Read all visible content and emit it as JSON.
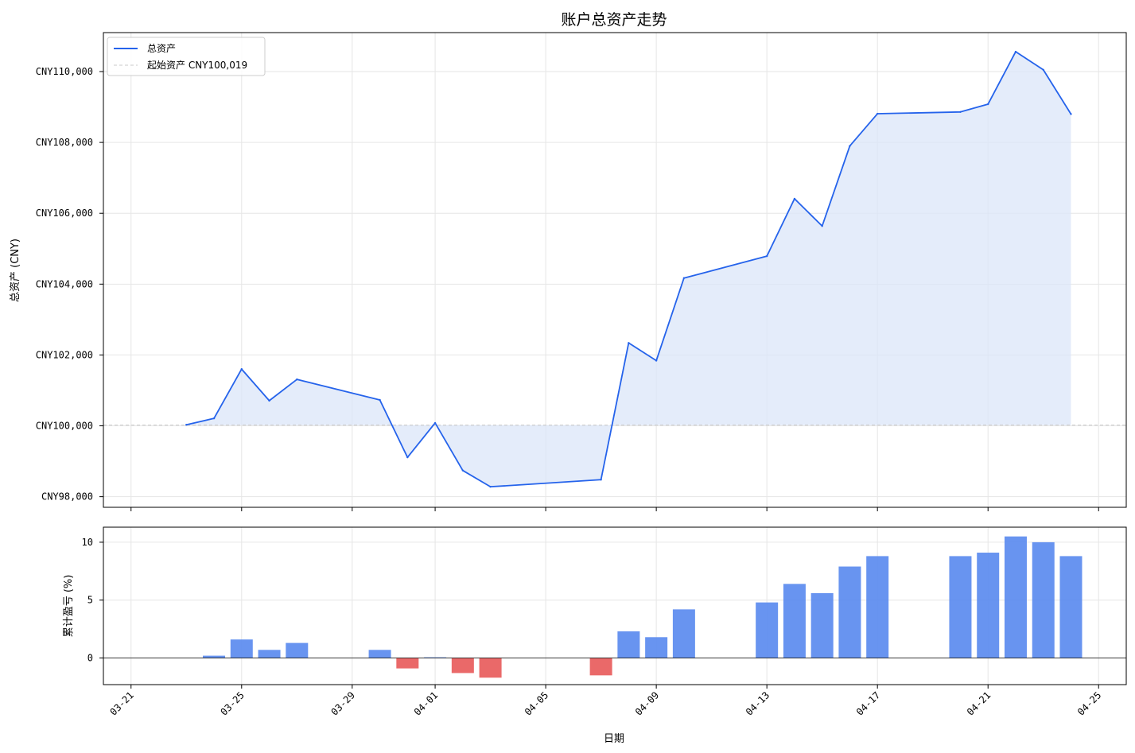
{
  "chart_data": [
    {
      "type": "area",
      "title": "账户总资产走势",
      "xlabel": "",
      "ylabel": "总资产 (CNY)",
      "ylim": [
        97700,
        111100
      ],
      "xlim": [
        "2024-03-20",
        "2024-04-26"
      ],
      "y_ticks": [
        98000,
        100000,
        102000,
        104000,
        106000,
        108000,
        110000
      ],
      "y_tick_labels": [
        "CNY98,000",
        "CNY100,000",
        "CNY102,000",
        "CNY104,000",
        "CNY106,000",
        "CNY108,000",
        "CNY110,000"
      ],
      "grid": true,
      "legend_position": "top-left",
      "series": [
        {
          "name": "总资产",
          "color": "#2563eb",
          "fill_color": "#dbe6f8",
          "x": [
            "2024-03-23",
            "2024-03-24",
            "2024-03-25",
            "2024-03-26",
            "2024-03-27",
            "2024-03-30",
            "2024-03-31",
            "2024-04-01",
            "2024-04-02",
            "2024-04-03",
            "2024-04-07",
            "2024-04-08",
            "2024-04-09",
            "2024-04-10",
            "2024-04-13",
            "2024-04-14",
            "2024-04-15",
            "2024-04-16",
            "2024-04-17",
            "2024-04-20",
            "2024-04-21",
            "2024-04-22",
            "2024-04-23",
            "2024-04-24"
          ],
          "values": [
            100030,
            100210,
            101600,
            100710,
            101310,
            100730,
            99110,
            100080,
            98740,
            98280,
            98480,
            102340,
            101840,
            104170,
            104790,
            106410,
            105640,
            107900,
            108810,
            108860,
            109080,
            110560,
            110050,
            108800
          ]
        }
      ],
      "reference_line": {
        "label": "起始资产 CNY100,019",
        "value": 100019,
        "color": "#c8c8c8"
      }
    },
    {
      "type": "bar",
      "title": "",
      "xlabel": "日期",
      "ylabel": "累计盈亏 (%)",
      "ylim": [
        -2.3,
        11.3
      ],
      "xlim": [
        "2024-03-20",
        "2024-04-26"
      ],
      "y_ticks": [
        0,
        5,
        10
      ],
      "y_tick_labels": [
        "0",
        "5",
        "10"
      ],
      "x_ticks": [
        "2024-03-21",
        "2024-03-25",
        "2024-03-29",
        "2024-04-01",
        "2024-04-05",
        "2024-04-09",
        "2024-04-13",
        "2024-04-17",
        "2024-04-21",
        "2024-04-25"
      ],
      "x_tick_labels": [
        "03-21",
        "03-25",
        "03-29",
        "04-01",
        "04-05",
        "04-09",
        "04-13",
        "04-17",
        "04-21",
        "04-25"
      ],
      "grid": true,
      "positive_color": "#5b8bef",
      "negative_color": "#e85c5c",
      "x": [
        "2024-03-24",
        "2024-03-25",
        "2024-03-26",
        "2024-03-27",
        "2024-03-30",
        "2024-03-31",
        "2024-04-01",
        "2024-04-02",
        "2024-04-03",
        "2024-04-07",
        "2024-04-08",
        "2024-04-09",
        "2024-04-10",
        "2024-04-13",
        "2024-04-14",
        "2024-04-15",
        "2024-04-16",
        "2024-04-17",
        "2024-04-20",
        "2024-04-21",
        "2024-04-22",
        "2024-04-23",
        "2024-04-24"
      ],
      "values": [
        0.2,
        1.6,
        0.7,
        1.3,
        0.7,
        -0.9,
        0.06,
        -1.3,
        -1.7,
        -1.5,
        2.3,
        1.8,
        4.2,
        4.8,
        6.4,
        5.6,
        7.9,
        8.8,
        8.8,
        9.1,
        10.5,
        10.0,
        8.8
      ]
    }
  ]
}
